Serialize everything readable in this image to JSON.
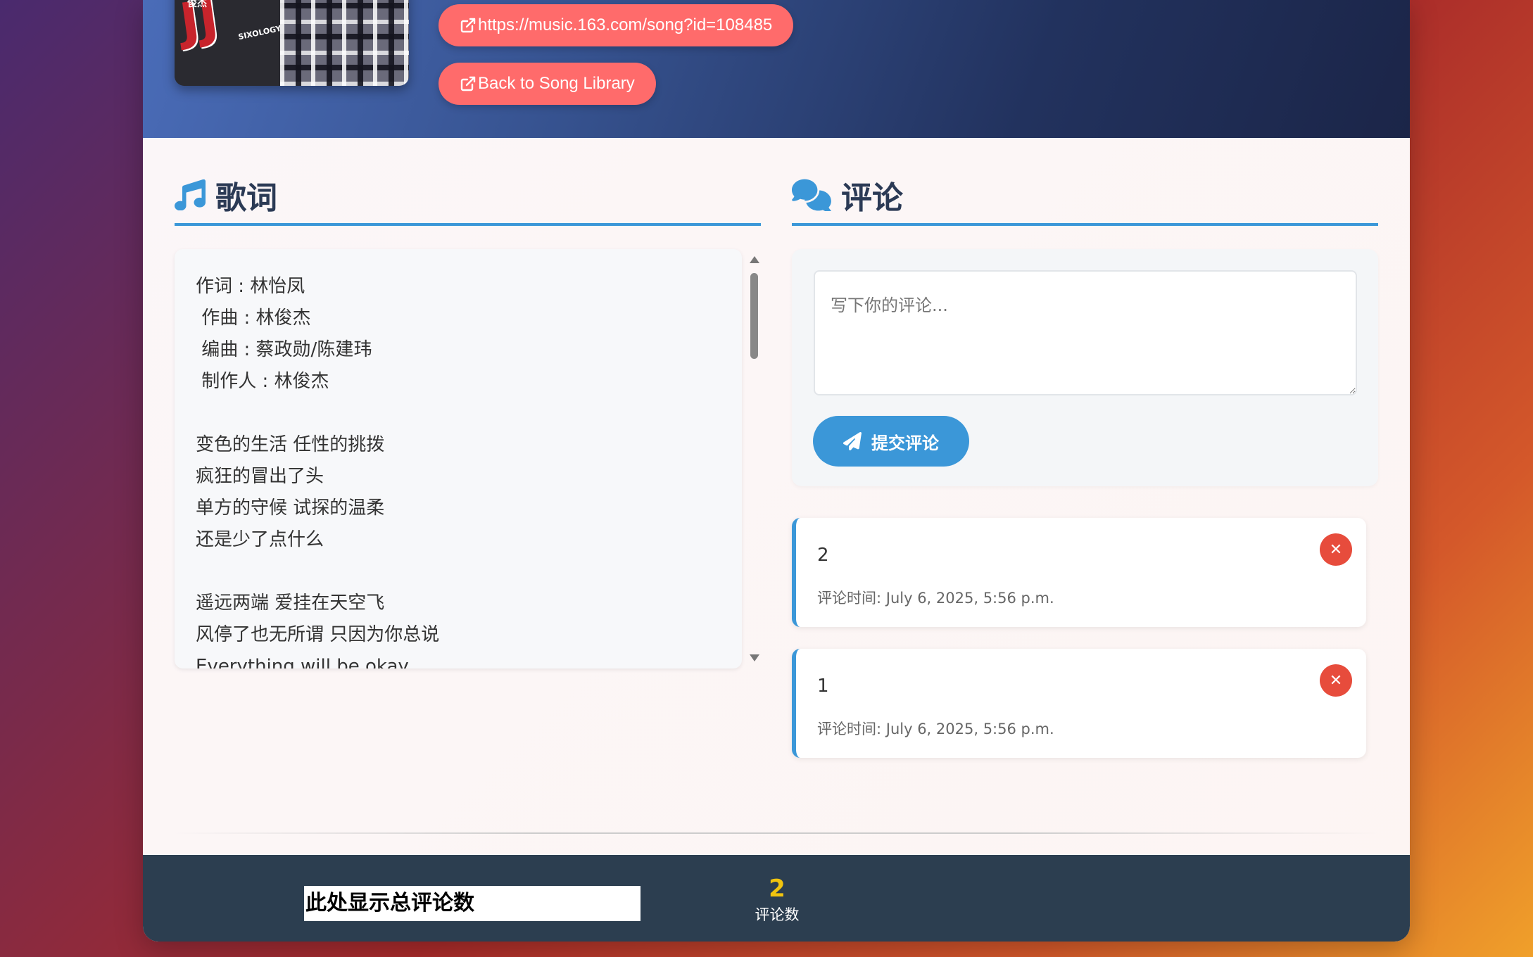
{
  "song": {
    "link_label": "https://music.163.com/song?id=108485",
    "back_label": "Back to Song Library",
    "album_art": {
      "badge": "俊杰",
      "glyph": "JJ陸",
      "watermark": "SIXOLOGY"
    }
  },
  "lyrics": {
    "title": "歌词",
    "text": "作词 : 林怡凤\n 作曲 : 林俊杰\n 编曲 : 蔡政勋/陈建玮\n 制作人 : 林俊杰\n\n变色的生活 任性的挑拨\n疯狂的冒出了头\n单方的守候 试探的温柔\n还是少了点什么\n\n遥远两端 爱挂在天空飞\n风停了也无所谓 只因为你总说\nEverything will be okay"
  },
  "comments": {
    "title": "评论",
    "input_placeholder": "写下你的评论...",
    "submit_label": "提交评论",
    "items": [
      {
        "content": "2",
        "time": "评论时间: July 6, 2025, 5:56 p.m.",
        "delete_label": "✕"
      },
      {
        "content": "1",
        "time": "评论时间: July 6, 2025, 5:56 p.m.",
        "delete_label": "✕"
      }
    ]
  },
  "footer": {
    "placeholder_label": "此处显示总评论数",
    "stats": {
      "value": "2",
      "label": "评论数"
    }
  },
  "colors": {
    "accent": "#3b97d8",
    "pill": "#ff6b6b",
    "delete": "#e74c3c",
    "footer_bg": "#2c3e50",
    "stat_value": "#f1c40f"
  },
  "icons": {
    "link": "external-link-icon",
    "lyrics": "music-note-icon",
    "comments": "comments-icon",
    "submit": "paper-plane-icon",
    "delete": "close-icon"
  }
}
